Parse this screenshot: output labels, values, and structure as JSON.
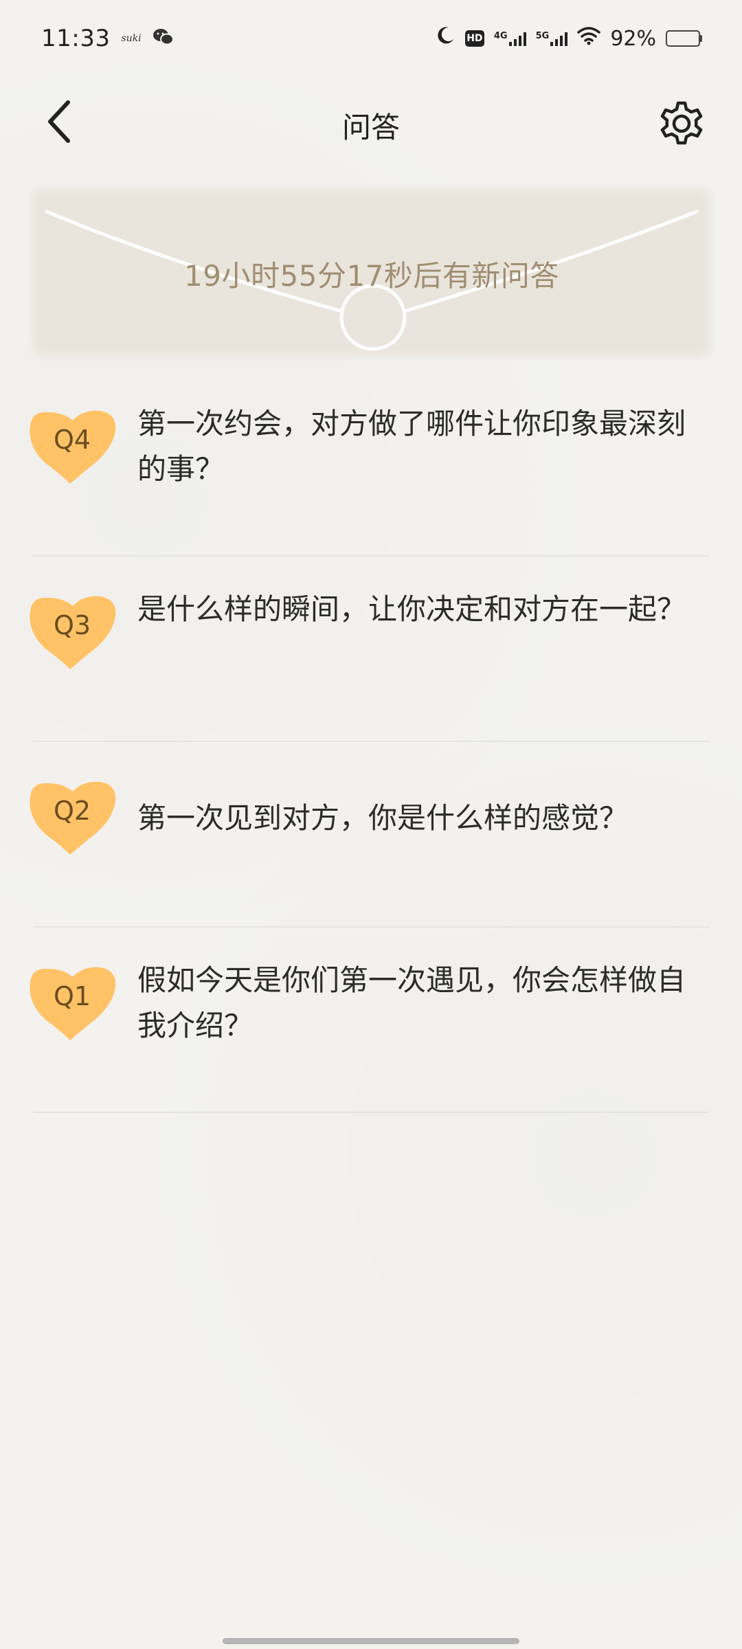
{
  "status_bar": {
    "time": "11:33",
    "app_tag": "suki",
    "net_4g": "4G",
    "net_5g": "5G",
    "hd": "HD",
    "battery": "92%",
    "battery_level": 0.92
  },
  "header": {
    "title": "问答"
  },
  "banner": {
    "countdown_text": "19小时55分17秒后有新问答"
  },
  "questions": [
    {
      "badge": "Q4",
      "text": "第一次约会，对方做了哪件让你印象最深刻的事？"
    },
    {
      "badge": "Q3",
      "text": "是什么样的瞬间，让你决定和对方在一起？"
    },
    {
      "badge": "Q2",
      "text": "第一次见到对方，你是什么样的感觉？"
    },
    {
      "badge": "Q1",
      "text": "假如今天是你们第一次遇见，你会怎样做自我介绍？"
    }
  ],
  "colors": {
    "badge": "#ffc266",
    "banner_bg": "#e9e5dc",
    "banner_text": "#a08e72",
    "page_bg": "#f3f2ef"
  }
}
